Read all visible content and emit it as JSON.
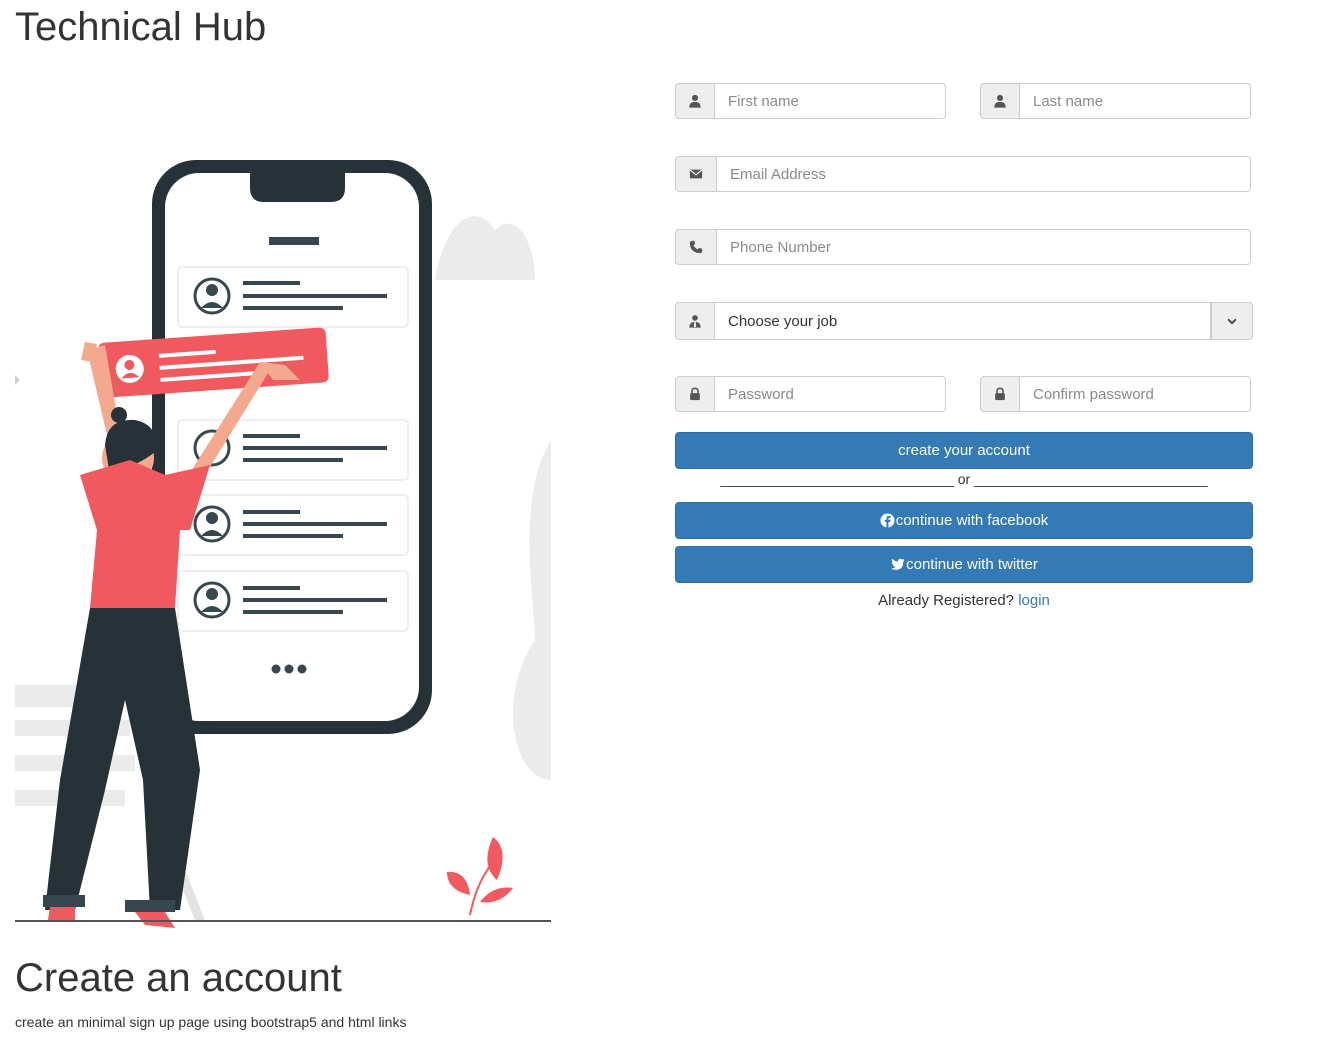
{
  "header": {
    "title": "Technical Hub"
  },
  "intro": {
    "heading": "Create an account",
    "description": "create an minimal sign up page using bootstrap5 and html links"
  },
  "form": {
    "first_name": {
      "placeholder": "First name",
      "icon": "user-icon"
    },
    "last_name": {
      "placeholder": "Last name",
      "icon": "user-icon"
    },
    "email": {
      "placeholder": "Email Address",
      "icon": "envelope-icon"
    },
    "phone": {
      "placeholder": "Phone Number",
      "icon": "phone-icon"
    },
    "job": {
      "selected": "Choose your job",
      "icon": "user-tie-icon"
    },
    "password": {
      "placeholder": "Password",
      "icon": "lock-icon"
    },
    "confirm_password": {
      "placeholder": "Confirm password",
      "icon": "lock-icon"
    },
    "create_button": "create your account",
    "divider": "______________________________ or ______________________________",
    "facebook_button": "continue with facebook",
    "twitter_button": "continue with twitter",
    "already_text": "Already Registered?",
    "login_link": "login"
  },
  "colors": {
    "primary": "#337ab7",
    "illustration_accent": "#f05a5f",
    "illustration_dark": "#263238"
  }
}
